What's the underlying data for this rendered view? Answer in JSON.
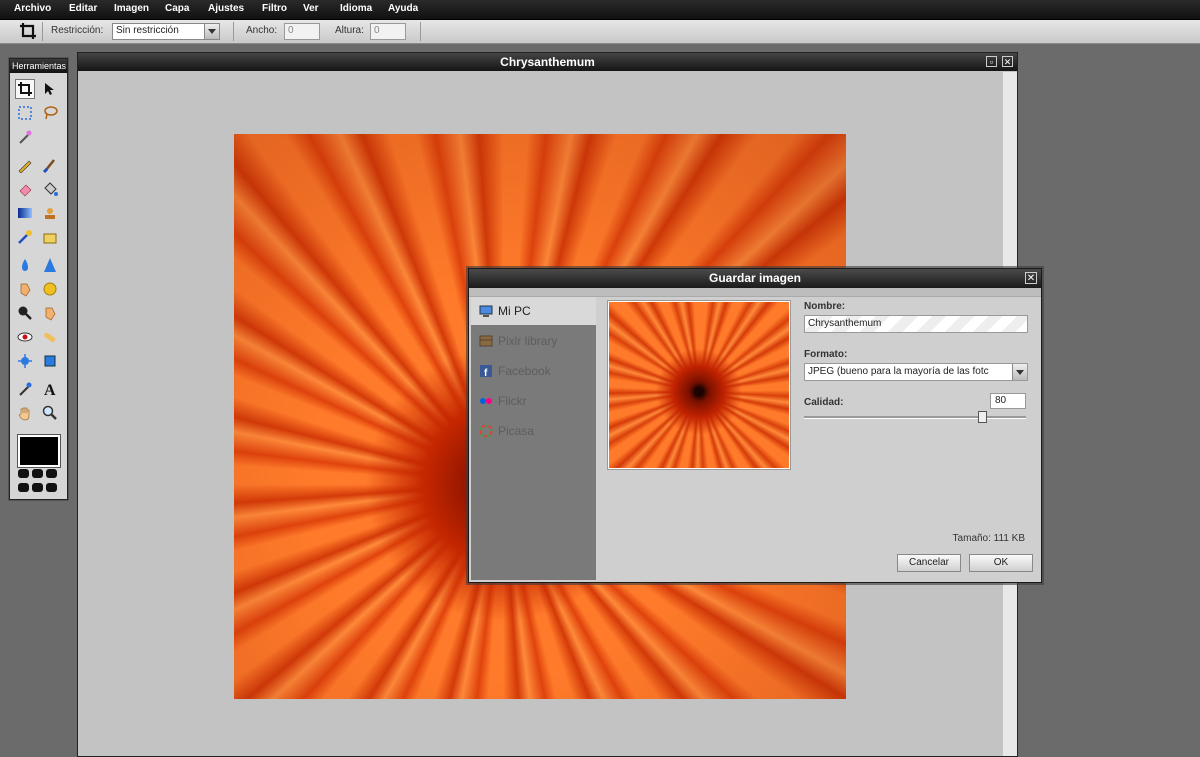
{
  "menu": [
    "Archivo",
    "Editar",
    "Imagen",
    "Capa",
    "Ajustes",
    "Filtro",
    "Ver",
    "Idioma",
    "Ayuda"
  ],
  "options": {
    "restriction_label": "Restricción:",
    "restriction_value": "Sin restricción",
    "width_label": "Ancho:",
    "width_value": "0",
    "height_label": "Altura:",
    "height_value": "0"
  },
  "tools_panel": {
    "title": "Herramientas"
  },
  "document": {
    "title": "Chrysanthemum"
  },
  "dialog": {
    "title": "Guardar imagen",
    "destinations": [
      "Mi PC",
      "Pixlr library",
      "Facebook",
      "Flickr",
      "Picasa"
    ],
    "name_label": "Nombre:",
    "name_value": "Chrysanthemum",
    "format_label": "Formato:",
    "format_value": "JPEG (bueno para la mayoría de las fotc",
    "quality_label": "Calidad:",
    "quality_value": "80",
    "quality_level": 80,
    "size_text": "Tamaño: 111 KB",
    "cancel": "Cancelar",
    "ok": "OK"
  }
}
